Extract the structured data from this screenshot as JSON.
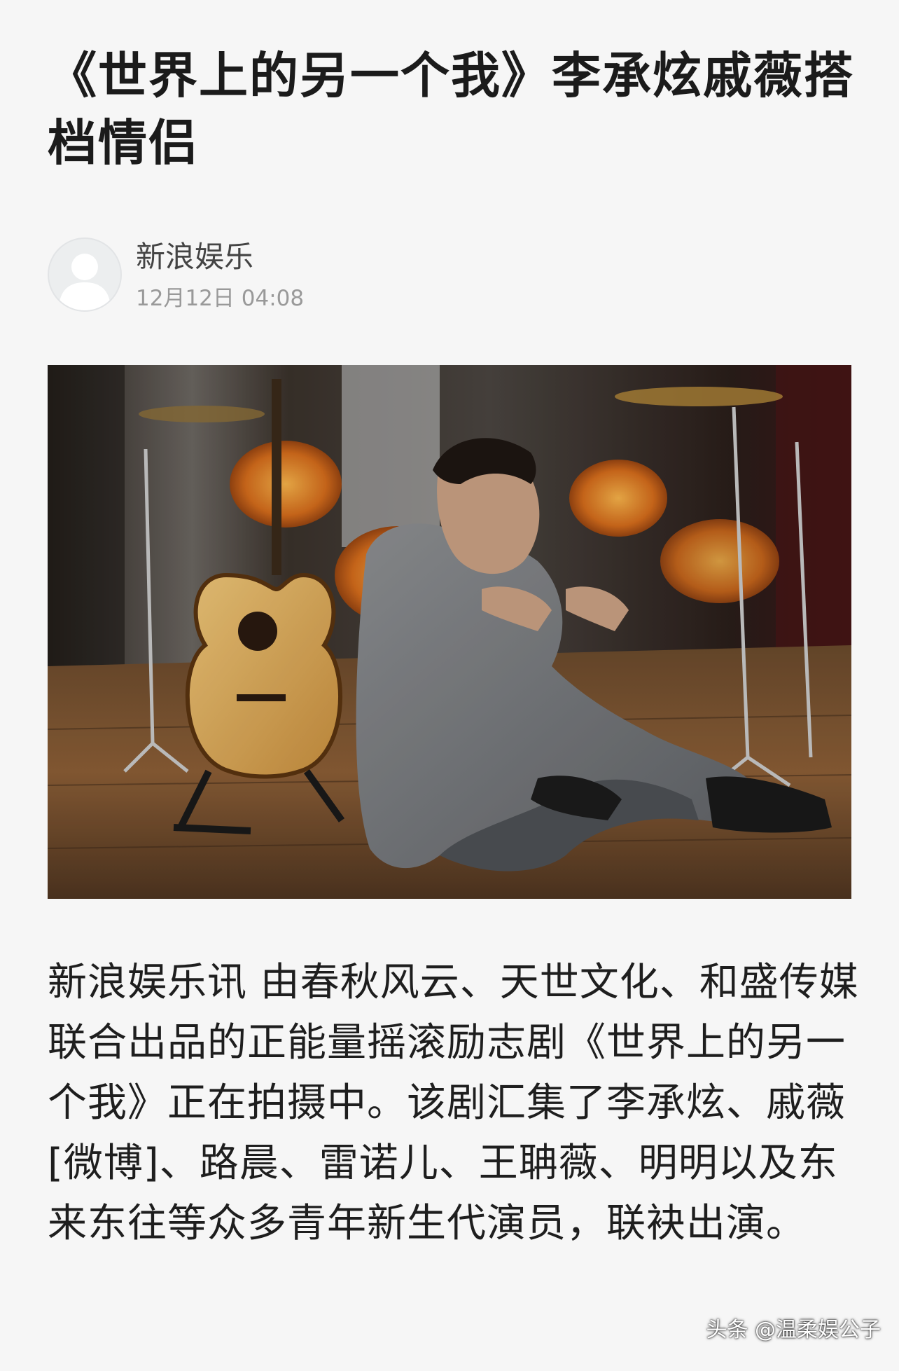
{
  "article": {
    "title": "《世界上的另一个我》李承炫戚薇搭档情侣",
    "author_name": "新浪娱乐",
    "publish_time": "12月12日 04:08",
    "body": "新浪娱乐讯 由春秋风云、天世文化、和盛传媒联合出品的正能量摇滚励志剧《世界上的另一个我》正在拍摄中。该剧汇集了李承炫、戚薇[微博]、路晨、雷诺儿、王聃薇、明明以及东来东往等众多青年新生代演员，联袂出演。"
  },
  "watermark": "头条 @温柔娱公子",
  "icons": {
    "avatar": "default-user-avatar-icon"
  },
  "colors": {
    "background": "#f6f6f6",
    "title": "#1b1b1b",
    "meta": "#999999"
  }
}
